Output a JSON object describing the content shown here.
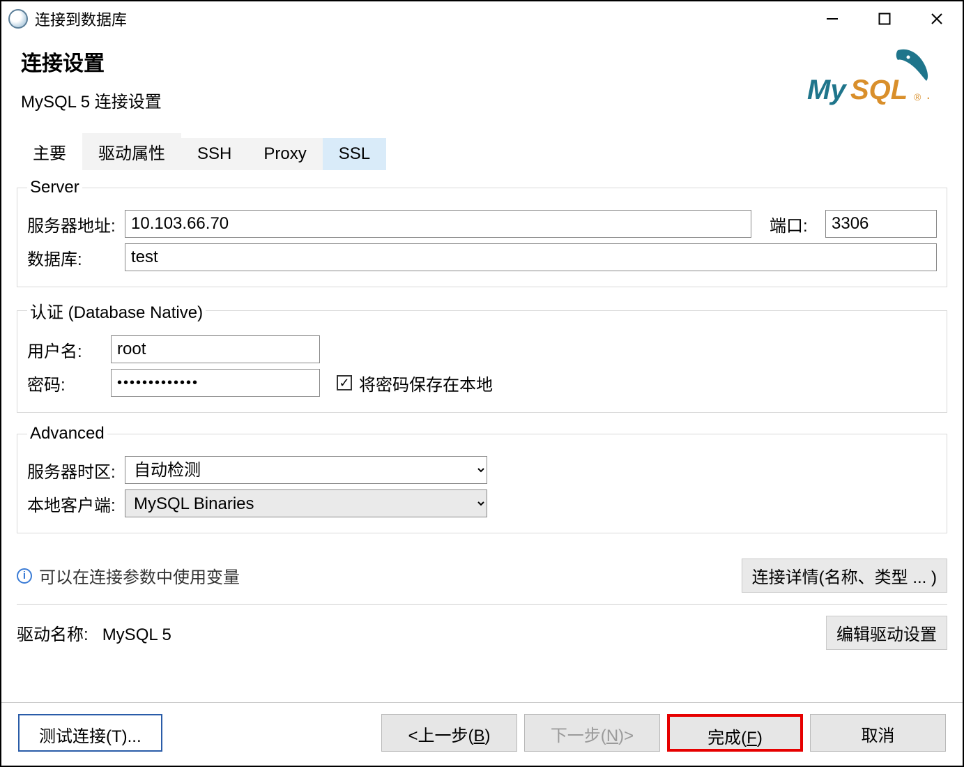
{
  "window": {
    "title": "连接到数据库"
  },
  "header": {
    "title": "连接设置",
    "subtitle": "MySQL 5 连接设置"
  },
  "tabs": {
    "main": "主要",
    "driver_props": "驱动属性",
    "ssh": "SSH",
    "proxy": "Proxy",
    "ssl": "SSL"
  },
  "groups": {
    "server": {
      "legend": "Server",
      "host_label": "服务器地址:",
      "host_value": "10.103.66.70",
      "port_label": "端口:",
      "port_value": "3306",
      "database_label": "数据库:",
      "database_value": "test"
    },
    "auth": {
      "legend": "认证 (Database Native)",
      "user_label": "用户名:",
      "user_value": "root",
      "password_label": "密码:",
      "password_value": "•••••••••••••",
      "save_local_label": "将密码保存在本地",
      "save_local_checked": true
    },
    "advanced": {
      "legend": "Advanced",
      "timezone_label": "服务器时区:",
      "timezone_value": "自动检测",
      "local_client_label": "本地客户端:",
      "local_client_value": "MySQL Binaries"
    }
  },
  "info": {
    "text": "可以在连接参数中使用变量",
    "details_button": "连接详情(名称、类型 ... )"
  },
  "driver": {
    "label": "驱动名称:",
    "name": "MySQL 5",
    "edit_button": "编辑驱动设置"
  },
  "footer": {
    "test": "测试连接(T)...",
    "back_pre": "<上一步(",
    "back_u": "B",
    "back_post": ")",
    "next_pre": "下一步(",
    "next_u": "N",
    "next_post": ")>",
    "finish_pre": "完成(",
    "finish_u": "F",
    "finish_post": ")",
    "cancel": "取消"
  }
}
